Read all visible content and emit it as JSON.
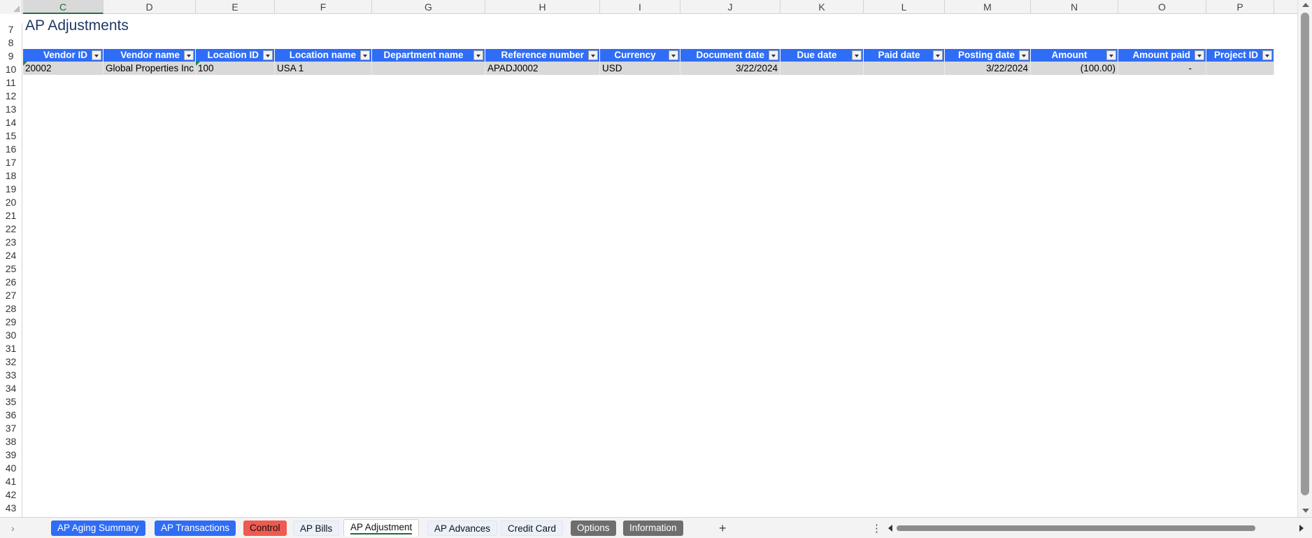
{
  "columns": {
    "letters": [
      "C",
      "D",
      "E",
      "F",
      "G",
      "H",
      "I",
      "J",
      "K",
      "L",
      "M",
      "N",
      "O",
      "P"
    ],
    "active": "C"
  },
  "rows": [
    "7",
    "8",
    "9",
    "10",
    "11",
    "12",
    "13",
    "14",
    "15",
    "16",
    "17",
    "18",
    "19",
    "20",
    "21",
    "22",
    "23",
    "24",
    "25",
    "26",
    "27",
    "28",
    "29",
    "30",
    "31",
    "32",
    "33",
    "34",
    "35",
    "36",
    "37",
    "38",
    "39",
    "40",
    "41",
    "42",
    "43"
  ],
  "sheet_title": "AP Adjustments",
  "table": {
    "headers": [
      "Vendor ID",
      "Vendor name",
      "Location ID",
      "Location name",
      "Department name",
      "Reference number",
      "Currency",
      "Document date",
      "Due date",
      "Paid date",
      "Posting date",
      "Amount",
      "Amount paid",
      "Project ID"
    ],
    "row": [
      "20002",
      "Global Properties Inc",
      "100",
      "USA 1",
      "",
      "APADJ0002",
      "USD",
      "3/22/2024",
      "",
      "",
      "3/22/2024",
      "(100.00)",
      "-",
      ""
    ]
  },
  "tabs": [
    {
      "label": "AP Aging Summary",
      "style": "blue"
    },
    {
      "label": "AP Transactions",
      "style": "blue"
    },
    {
      "label": "Control",
      "style": "red"
    },
    {
      "label": "AP Bills",
      "style": "plain"
    },
    {
      "label": "AP Adjustment",
      "style": "active"
    },
    {
      "label": "AP Advances",
      "style": "plain"
    },
    {
      "label": "Credit Card",
      "style": "plain"
    },
    {
      "label": "Options",
      "style": "grey"
    },
    {
      "label": "Information",
      "style": "grey"
    }
  ],
  "colors": {
    "header_blue": "#2f6df6",
    "row_grey": "#d9d9d9",
    "title_navy": "#1f3864",
    "active_green": "#217346"
  },
  "icons": {
    "add_sheet": "+",
    "more": "⋮",
    "prev": "›"
  }
}
